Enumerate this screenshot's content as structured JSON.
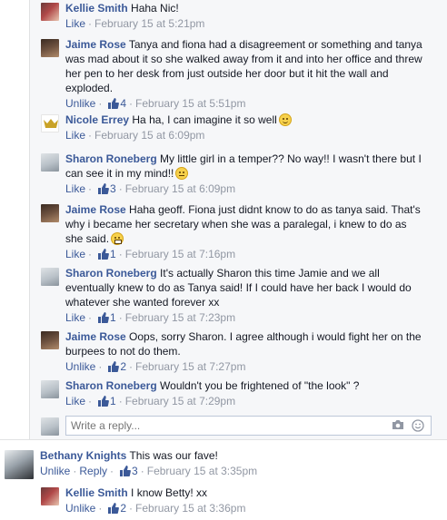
{
  "comments": [
    {
      "id": "c1",
      "author": "Kellie Smith",
      "text": "Haha Nic!",
      "meta": {
        "actions": [
          "Like"
        ],
        "likes": "",
        "time": "February 15 at 5:21pm"
      }
    },
    {
      "id": "c2",
      "author": "Jaime Rose",
      "text": "Tanya and fiona had a disagreement or something and tanya was mad about it so she walked away from it and into her office and threw her pen to her desk from just outside her door but it hit the wall and exploded.",
      "meta": {
        "actions": [
          "Unlike"
        ],
        "likes": "4",
        "time": "February 15 at 5:51pm"
      }
    },
    {
      "id": "c3",
      "author": "Nicole Errey",
      "text": "Ha ha, I can imagine it so well",
      "meta": {
        "actions": [
          "Like"
        ],
        "likes": "",
        "time": "February 15 at 6:09pm"
      }
    },
    {
      "id": "c4",
      "author": "Sharon Roneberg",
      "text": "My little girl in a temper?? No way!! I wasn't there but I can see it in my mind!!",
      "meta": {
        "actions": [
          "Like"
        ],
        "likes": "3",
        "time": "February 15 at 6:09pm"
      }
    },
    {
      "id": "c5",
      "author": "Jaime Rose",
      "text": "Haha geoff. Fiona just didnt know to do as tanya said. That's why i became her secretary when she was a paralegal, i knew to do as she said.",
      "meta": {
        "actions": [
          "Like"
        ],
        "likes": "1",
        "time": "February 15 at 7:16pm"
      }
    },
    {
      "id": "c6",
      "author": "Sharon Roneberg",
      "text": "It's actually Sharon this time Jamie and we all eventually knew to do as Tanya said! If I could have her back I would do whatever she wanted forever xx",
      "meta": {
        "actions": [
          "Like"
        ],
        "likes": "1",
        "time": "February 15 at 7:23pm"
      }
    },
    {
      "id": "c7",
      "author": "Jaime Rose",
      "text": "Oops, sorry Sharon. I agree although i would fight her on the burpees to not do them.",
      "meta": {
        "actions": [
          "Unlike"
        ],
        "likes": "2",
        "time": "February 15 at 7:27pm"
      }
    },
    {
      "id": "c8",
      "author": "Sharon Roneberg",
      "text": "Wouldn't you be frightened of \"the look\" ?",
      "meta": {
        "actions": [
          "Like"
        ],
        "likes": "1",
        "time": "February 15 at 7:29pm"
      }
    },
    {
      "id": "c9",
      "author": "Bethany Knights",
      "text": "This was our fave!",
      "meta": {
        "actions": [
          "Unlike",
          "Reply"
        ],
        "likes": "3",
        "time": "February 15 at 3:35pm"
      }
    },
    {
      "id": "c10",
      "author": "Kellie Smith",
      "text": "I know Betty! xx",
      "meta": {
        "actions": [
          "Unlike"
        ],
        "likes": "2",
        "time": "February 15 at 3:36pm"
      }
    }
  ],
  "reply_box": {
    "placeholder": "Write a reply..."
  },
  "icons": {
    "like": "thumbs-up-icon",
    "camera": "camera-icon",
    "emoji": "emoji-icon"
  },
  "colors": {
    "link": "#3b5998",
    "meta": "#9197a3",
    "thread_bg": "#f6f7f9"
  }
}
